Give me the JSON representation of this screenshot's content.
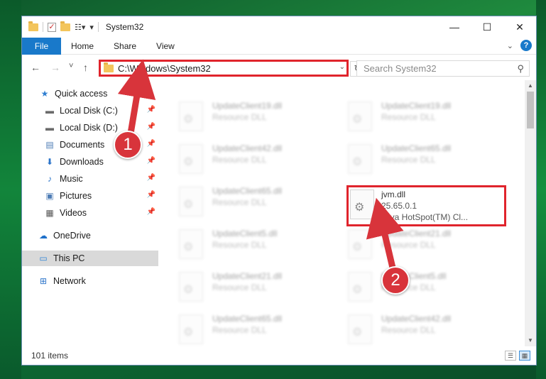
{
  "window": {
    "title": "System32",
    "controls": {
      "minimize": "—",
      "maximize": "☐",
      "close": "✕"
    }
  },
  "ribbon": {
    "tabs": [
      "File",
      "Home",
      "Share",
      "View"
    ],
    "expand_icon": "chevron-down-icon",
    "help_label": "?"
  },
  "nav": {
    "back": "←",
    "forward": "→",
    "recent": "˅",
    "up": "↑",
    "address": "C:\\Windows\\System32",
    "refresh": "↻",
    "search_placeholder": "Search System32"
  },
  "sidebar": {
    "items": [
      {
        "label": "Quick access",
        "icon": "star-icon",
        "glyph": "★",
        "color": "#2f7fd1",
        "pinned": false
      },
      {
        "label": "Local Disk (C:)",
        "icon": "drive-icon",
        "glyph": "▬",
        "color": "#6b6b6b",
        "pinned": true
      },
      {
        "label": "Local Disk (D:)",
        "icon": "drive-icon",
        "glyph": "▬",
        "color": "#6b6b6b",
        "pinned": true
      },
      {
        "label": "Documents",
        "icon": "document-icon",
        "glyph": "▤",
        "color": "#4d7cb5",
        "pinned": true
      },
      {
        "label": "Downloads",
        "icon": "download-icon",
        "glyph": "⬇",
        "color": "#2a73c9",
        "pinned": true
      },
      {
        "label": "Music",
        "icon": "music-icon",
        "glyph": "♪",
        "color": "#2a73c9",
        "pinned": true
      },
      {
        "label": "Pictures",
        "icon": "pictures-icon",
        "glyph": "▣",
        "color": "#4d7cb5",
        "pinned": true
      },
      {
        "label": "Videos",
        "icon": "video-icon",
        "glyph": "▦",
        "color": "#555",
        "pinned": true
      },
      {
        "label": "OneDrive",
        "icon": "cloud-icon",
        "glyph": "☁",
        "color": "#1d6fc9",
        "pinned": false
      },
      {
        "label": "This PC",
        "icon": "computer-icon",
        "glyph": "▭",
        "color": "#2a82d6",
        "pinned": false,
        "selected": true
      },
      {
        "label": "Network",
        "icon": "network-icon",
        "glyph": "⊞",
        "color": "#2a73c9",
        "pinned": false
      }
    ]
  },
  "files": {
    "left_column": [
      {
        "name": "UpdateClient19.dll",
        "type": "Resource DLL"
      },
      {
        "name": "UpdateClient42.dll",
        "type": "Resource DLL"
      },
      {
        "name": "UpdateClient65.dll",
        "type": "Resource DLL"
      },
      {
        "name": "UpdateClient5.dll",
        "type": "Resource DLL"
      },
      {
        "name": "UpdateClient21.dll",
        "type": "Resource DLL"
      },
      {
        "name": "UpdateClient65.dll",
        "type": "Resource DLL"
      }
    ],
    "right_column": [
      {
        "name": "UpdateClient19.dll",
        "type": "Resource DLL"
      },
      {
        "name": "UpdateClient65.dll",
        "type": "Resource DLL"
      },
      {
        "name": "UpdateClient21.dll",
        "type": "Resource DLL"
      },
      {
        "name": "UpdateClient5.dll",
        "type": "Resource DLL"
      },
      {
        "name": "UpdateClient42.dll",
        "type": "Resource DLL"
      }
    ],
    "highlighted": {
      "name": "jvm.dll",
      "version": "25.65.0.1",
      "description": "Java HotSpot(TM) Cl..."
    }
  },
  "status": {
    "item_count": "101 items"
  },
  "annotations": {
    "step1": "1",
    "step2": "2",
    "color": "#d8343b"
  }
}
